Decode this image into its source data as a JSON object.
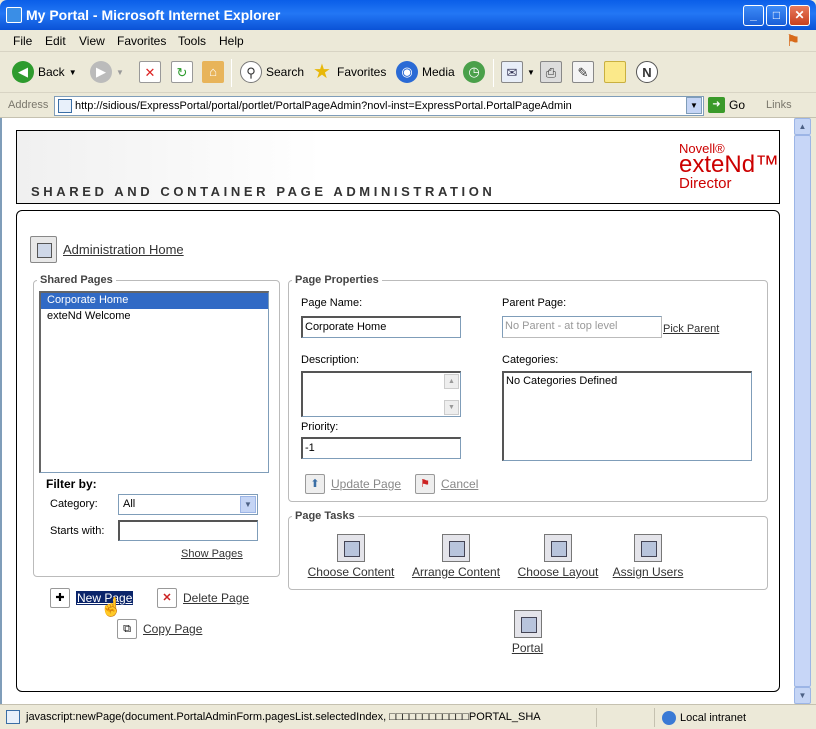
{
  "window": {
    "title": "My Portal - Microsoft Internet Explorer"
  },
  "menu": [
    "File",
    "Edit",
    "View",
    "Favorites",
    "Tools",
    "Help"
  ],
  "toolbar": {
    "back": "Back",
    "search": "Search",
    "favorites": "Favorites",
    "media": "Media"
  },
  "address": {
    "label": "Address",
    "url": "http://sidious/ExpressPortal/portal/portlet/PortalPageAdmin?novl-inst=ExpressPortal.PortalPageAdmin",
    "go": "Go",
    "links": "Links"
  },
  "header": {
    "title": "SHARED AND CONTAINER PAGE ADMINISTRATION",
    "brand_line1": "Novell®",
    "brand_line2": "exteNd™",
    "brand_line3": "Director"
  },
  "nav": {
    "admin_home": "Administration Home"
  },
  "shared_pages": {
    "legend": "Shared Pages",
    "items": [
      "Corporate Home",
      "exteNd Welcome"
    ],
    "selected_index": 0,
    "filter_title": "Filter by:",
    "category_label": "Category:",
    "category_value": "All",
    "starts_with_label": "Starts with:",
    "starts_with_value": "",
    "show_pages": "Show Pages"
  },
  "page_properties": {
    "legend": "Page Properties",
    "page_name_label": "Page Name:",
    "page_name_value": "Corporate Home",
    "parent_page_label": "Parent Page:",
    "parent_page_value": "No Parent - at top level",
    "pick_parent": "Pick Parent",
    "description_label": "Description:",
    "description_value": "",
    "categories_label": "Categories:",
    "categories_value": "No Categories Defined",
    "priority_label": "Priority:",
    "priority_value": "-1",
    "update_page": "Update Page",
    "cancel": "Cancel"
  },
  "page_tasks": {
    "legend": "Page Tasks",
    "choose_content": "Choose Content",
    "arrange_content": "Arrange Content",
    "choose_layout": "Choose Layout",
    "assign_users": "Assign Users",
    "portal": "Portal"
  },
  "page_actions": {
    "new_page": "New Page",
    "delete_page": "Delete Page",
    "copy_page": "Copy Page"
  },
  "status": {
    "text": "javascript:newPage(document.PortalAdminForm.pagesList.selectedIndex, □□□□□□□□□□□□PORTAL_SHA",
    "zone": "Local intranet"
  }
}
